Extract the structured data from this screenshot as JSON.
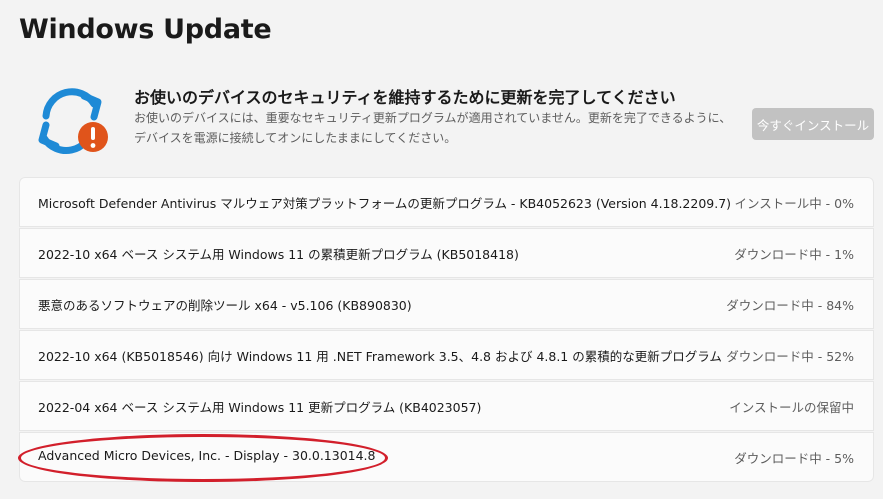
{
  "page": {
    "title": "Windows Update"
  },
  "status": {
    "icon": "sync-warning-icon",
    "heading": "お使いのデバイスのセキュリティを維持するために更新を完了してください",
    "description": "お使いのデバイスには、重要なセキュリティ更新プログラムが適用されていません。更新を完了できるように、デバイスを電源に接続してオンにしたままにしてください。",
    "install_button": "今すぐインストール",
    "colors": {
      "sync": "#1e8ad6",
      "warning": "#e0541b",
      "button_disabled": "#c2c2c2"
    }
  },
  "updates": [
    {
      "name": "Microsoft Defender Antivirus マルウェア対策プラットフォームの更新プログラム - KB4052623 (Version 4.18.2209.7)",
      "status": "インストール中 - 0%"
    },
    {
      "name": "2022-10 x64 ベース システム用 Windows 11 の累積更新プログラム (KB5018418)",
      "status": "ダウンロード中 - 1%"
    },
    {
      "name": "悪意のあるソフトウェアの削除ツール x64 - v5.106 (KB890830)",
      "status": "ダウンロード中 - 84%"
    },
    {
      "name": "2022-10 x64 (KB5018546) 向け Windows 11 用 .NET Framework 3.5、4.8 および 4.8.1 の累積的な更新プログラム",
      "status": "ダウンロード中 - 52%"
    },
    {
      "name": "2022-04 x64 ベース システム用 Windows 11 更新プログラム (KB4023057)",
      "status": "インストールの保留中"
    },
    {
      "name": "Advanced Micro Devices, Inc. - Display - 30.0.13014.8",
      "status": "ダウンロード中 - 5%"
    }
  ],
  "annotation": {
    "color": "#d21f2b"
  }
}
